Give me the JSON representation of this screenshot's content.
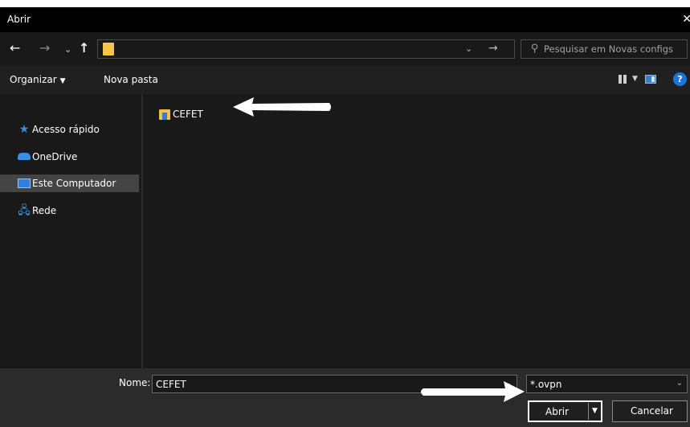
{
  "dialog": {
    "title": "Abrir",
    "close_glyph": "✕"
  },
  "address": {
    "path": "",
    "search_placeholder": "Pesquisar em Novas configs"
  },
  "toolbar": {
    "organize_label": "Organizar",
    "new_folder_label": "Nova pasta"
  },
  "sidebar": {
    "items": [
      {
        "label": "Acesso rápido",
        "icon": "star-icon"
      },
      {
        "label": "OneDrive",
        "icon": "cloud-icon"
      },
      {
        "label": "Este Computador",
        "icon": "computer-icon",
        "selected": true
      },
      {
        "label": "Rede",
        "icon": "network-icon"
      }
    ]
  },
  "files": [
    {
      "name": "CEFET",
      "icon": "folder-icon"
    }
  ],
  "footer": {
    "name_label": "Nome:",
    "name_value": "CEFET",
    "filter_value": "*.ovpn",
    "open_label": "Abrir",
    "cancel_label": "Cancelar"
  },
  "colors": {
    "accent": "#1e73d9",
    "folder": "#f0c24a",
    "background": "#191919"
  }
}
